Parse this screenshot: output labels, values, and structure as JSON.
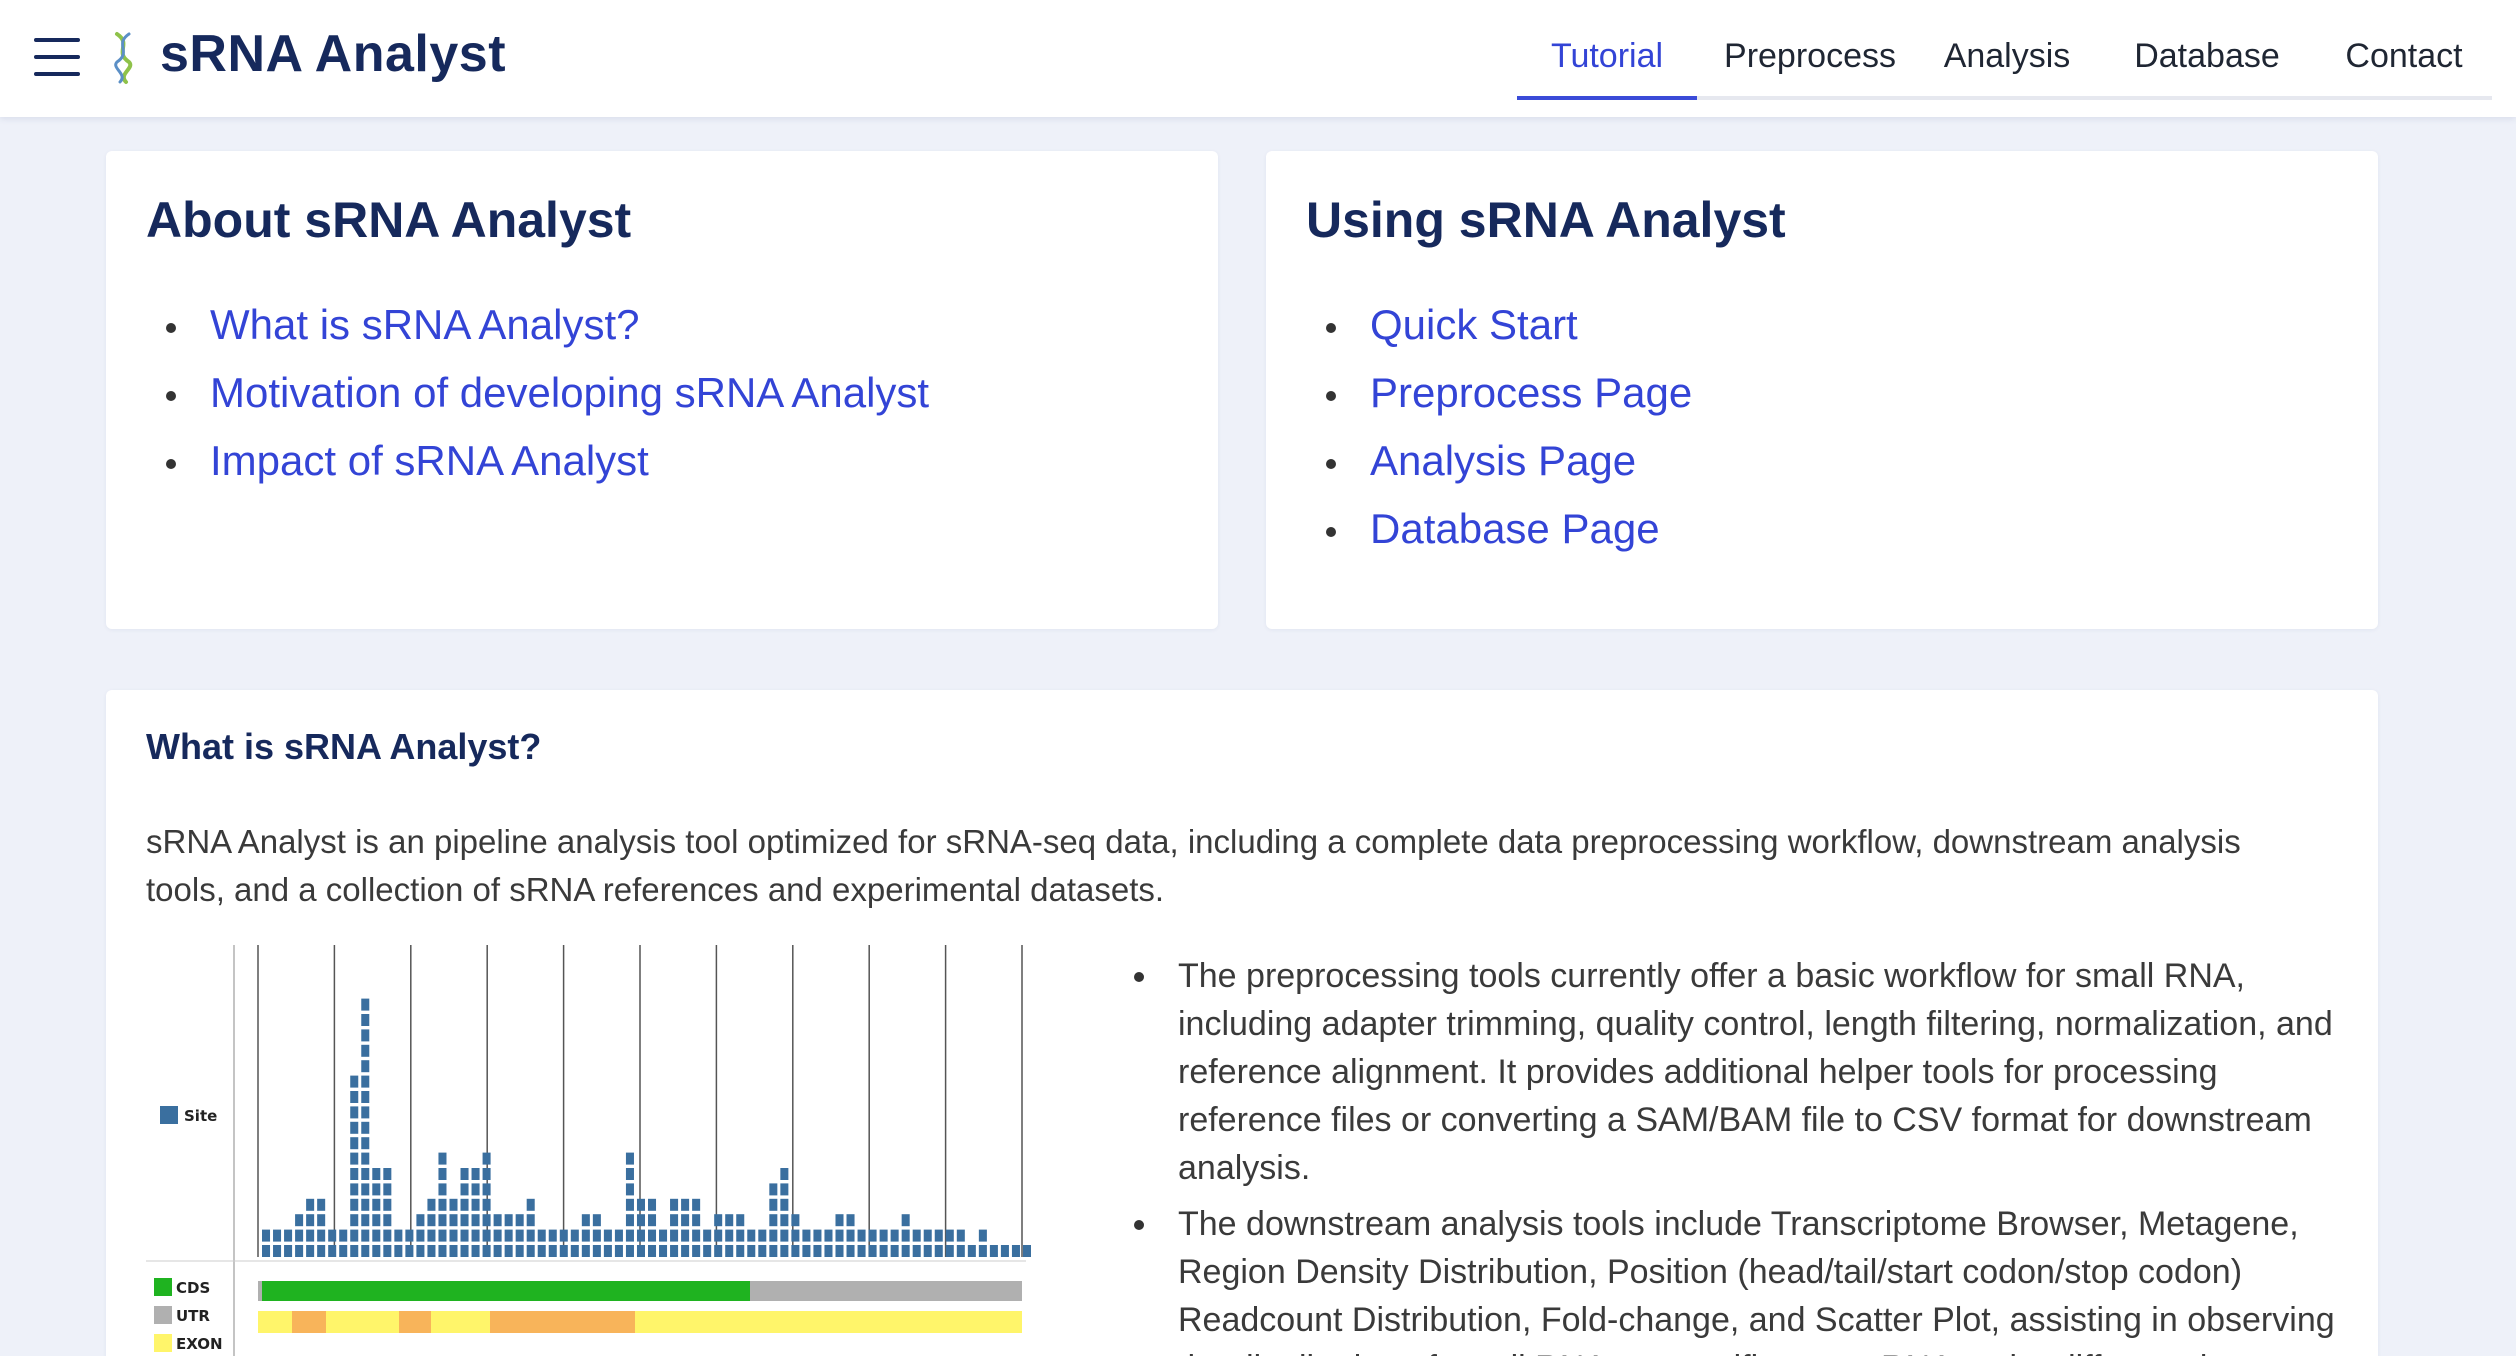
{
  "header": {
    "app_title": "sRNA Analyst",
    "menu_icon": "hamburger-menu-icon",
    "logo_icon": "dna-helix-icon",
    "nav": [
      {
        "label": "Tutorial",
        "active": true
      },
      {
        "label": "Preprocess",
        "active": false
      },
      {
        "label": "Analysis",
        "active": false
      },
      {
        "label": "Database",
        "active": false
      },
      {
        "label": "Contact",
        "active": false
      }
    ]
  },
  "about_card": {
    "title": "About sRNA Analyst",
    "links": [
      "What is sRNA Analyst?",
      "Motivation of developing sRNA Analyst",
      "Impact of sRNA Analyst"
    ]
  },
  "using_card": {
    "title": "Using sRNA Analyst",
    "links": [
      "Quick Start",
      "Preprocess Page",
      "Analysis Page",
      "Database Page"
    ]
  },
  "what_is": {
    "title": "What is sRNA Analyst?",
    "intro": "sRNA Analyst is an pipeline analysis tool optimized for sRNA-seq data, including a complete data preprocessing workflow, downstream analysis tools, and a collection of sRNA references and experimental datasets.",
    "bullets": [
      "The preprocessing tools currently offer a basic workflow for small RNA, including adapter trimming, quality control, length filtering, normalization, and reference alignment. It provides additional helper tools for processing reference files or converting a SAM/BAM file to CSV format for downstream analysis.",
      "The downstream analysis tools include Transcriptome Browser, Metagene, Region Density Distribution, Position (head/tail/start codon/stop codon) Readcount Distribution, Fold-change, and Scatter Plot, assisting in observing the distribution of small RNA on specific target RNA under different datasets."
    ],
    "figure": {
      "legend_site": "Site",
      "legend_cds": "CDS",
      "legend_utr": "UTR",
      "legend_exon": "EXON",
      "colors": {
        "site": "#3a6f9f",
        "cds": "#1fb320",
        "utr": "#b0b0b0",
        "exon": "#fff56a",
        "exon_dark": "#f8b45a"
      },
      "site_column_heights": [
        2,
        2,
        2,
        3,
        4,
        4,
        2,
        2,
        12,
        17,
        6,
        6,
        2,
        2,
        3,
        4,
        7,
        4,
        6,
        6,
        7,
        3,
        3,
        3,
        4,
        2,
        2,
        2,
        2,
        3,
        3,
        2,
        2,
        7,
        4,
        4,
        2,
        4,
        4,
        4,
        2,
        3,
        3,
        3,
        2,
        2,
        5,
        6,
        3,
        2,
        2,
        2,
        3,
        3,
        2,
        2,
        2,
        2,
        3,
        2,
        2,
        2,
        2,
        2,
        1,
        2,
        1,
        1,
        1,
        1
      ]
    }
  }
}
